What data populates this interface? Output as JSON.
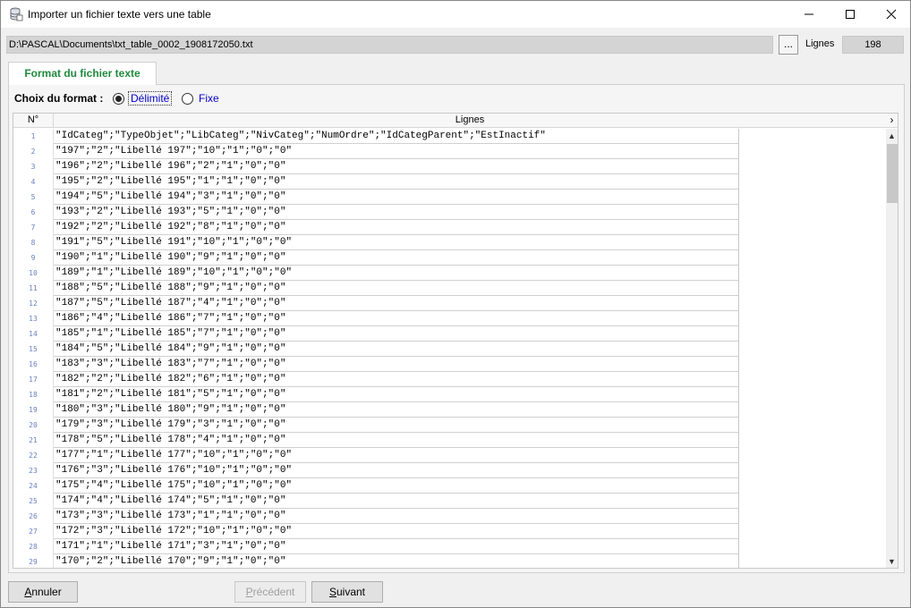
{
  "window": {
    "title": "Importer un fichier texte vers une table"
  },
  "file": {
    "path": "D:\\PASCAL\\Documents\\txt_table_0002_1908172050.txt",
    "browse_label": "...",
    "lines_label": "Lignes",
    "lines_count": "198"
  },
  "tab": {
    "label": "Format du fichier texte"
  },
  "format": {
    "label": "Choix du format :",
    "options": [
      "Délimité",
      "Fixe"
    ],
    "selected": "Délimité"
  },
  "grid": {
    "col_no": "N°",
    "col_lines": "Lignes",
    "rows": [
      {
        "n": "1",
        "text": "\"IdCateg\";\"TypeObjet\";\"LibCateg\";\"NivCateg\";\"NumOrdre\";\"IdCategParent\";\"EstInactif\""
      },
      {
        "n": "2",
        "text": "\"197\";\"2\";\"Libellé 197\";\"10\";\"1\";\"0\";\"0\""
      },
      {
        "n": "3",
        "text": "\"196\";\"2\";\"Libellé 196\";\"2\";\"1\";\"0\";\"0\""
      },
      {
        "n": "4",
        "text": "\"195\";\"2\";\"Libellé 195\";\"1\";\"1\";\"0\";\"0\""
      },
      {
        "n": "5",
        "text": "\"194\";\"5\";\"Libellé 194\";\"3\";\"1\";\"0\";\"0\""
      },
      {
        "n": "6",
        "text": "\"193\";\"2\";\"Libellé 193\";\"5\";\"1\";\"0\";\"0\""
      },
      {
        "n": "7",
        "text": "\"192\";\"2\";\"Libellé 192\";\"8\";\"1\";\"0\";\"0\""
      },
      {
        "n": "8",
        "text": "\"191\";\"5\";\"Libellé 191\";\"10\";\"1\";\"0\";\"0\""
      },
      {
        "n": "9",
        "text": "\"190\";\"1\";\"Libellé 190\";\"9\";\"1\";\"0\";\"0\""
      },
      {
        "n": "10",
        "text": "\"189\";\"1\";\"Libellé 189\";\"10\";\"1\";\"0\";\"0\""
      },
      {
        "n": "11",
        "text": "\"188\";\"5\";\"Libellé 188\";\"9\";\"1\";\"0\";\"0\""
      },
      {
        "n": "12",
        "text": "\"187\";\"5\";\"Libellé 187\";\"4\";\"1\";\"0\";\"0\""
      },
      {
        "n": "13",
        "text": "\"186\";\"4\";\"Libellé 186\";\"7\";\"1\";\"0\";\"0\""
      },
      {
        "n": "14",
        "text": "\"185\";\"1\";\"Libellé 185\";\"7\";\"1\";\"0\";\"0\""
      },
      {
        "n": "15",
        "text": "\"184\";\"5\";\"Libellé 184\";\"9\";\"1\";\"0\";\"0\""
      },
      {
        "n": "16",
        "text": "\"183\";\"3\";\"Libellé 183\";\"7\";\"1\";\"0\";\"0\""
      },
      {
        "n": "17",
        "text": "\"182\";\"2\";\"Libellé 182\";\"6\";\"1\";\"0\";\"0\""
      },
      {
        "n": "18",
        "text": "\"181\";\"2\";\"Libellé 181\";\"5\";\"1\";\"0\";\"0\""
      },
      {
        "n": "19",
        "text": "\"180\";\"3\";\"Libellé 180\";\"9\";\"1\";\"0\";\"0\""
      },
      {
        "n": "20",
        "text": "\"179\";\"3\";\"Libellé 179\";\"3\";\"1\";\"0\";\"0\""
      },
      {
        "n": "21",
        "text": "\"178\";\"5\";\"Libellé 178\";\"4\";\"1\";\"0\";\"0\""
      },
      {
        "n": "22",
        "text": "\"177\";\"1\";\"Libellé 177\";\"10\";\"1\";\"0\";\"0\""
      },
      {
        "n": "23",
        "text": "\"176\";\"3\";\"Libellé 176\";\"10\";\"1\";\"0\";\"0\""
      },
      {
        "n": "24",
        "text": "\"175\";\"4\";\"Libellé 175\";\"10\";\"1\";\"0\";\"0\""
      },
      {
        "n": "25",
        "text": "\"174\";\"4\";\"Libellé 174\";\"5\";\"1\";\"0\";\"0\""
      },
      {
        "n": "26",
        "text": "\"173\";\"3\";\"Libellé 173\";\"1\";\"1\";\"0\";\"0\""
      },
      {
        "n": "27",
        "text": "\"172\";\"3\";\"Libellé 172\";\"10\";\"1\";\"0\";\"0\""
      },
      {
        "n": "28",
        "text": "\"171\";\"1\";\"Libellé 171\";\"3\";\"1\";\"0\";\"0\""
      },
      {
        "n": "29",
        "text": "\"170\";\"2\";\"Libellé 170\";\"9\";\"1\";\"0\";\"0\""
      }
    ]
  },
  "buttons": {
    "cancel": "Annuler",
    "previous": "Précédent",
    "next": "Suivant"
  },
  "colors": {
    "tab_text": "#1f8a3c",
    "radio_text": "#0000c8",
    "row_number": "#6a7fc2"
  }
}
